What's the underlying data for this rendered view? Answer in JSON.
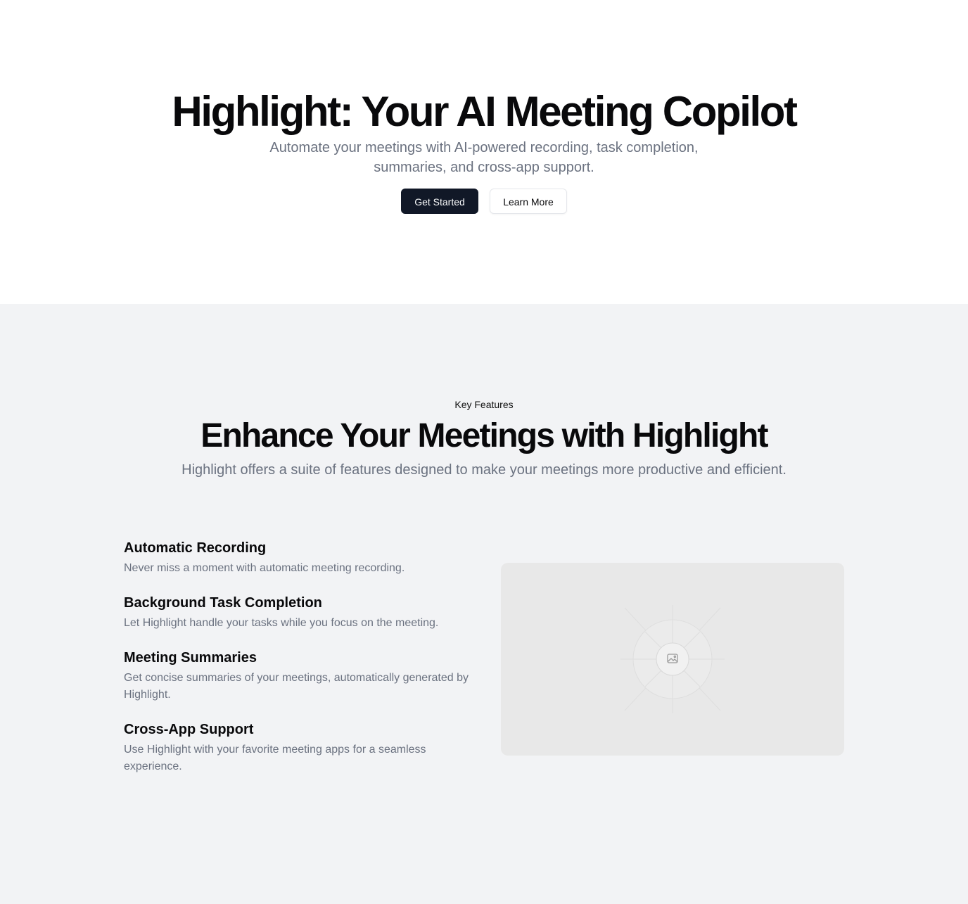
{
  "hero": {
    "title": "Highlight: Your AI Meeting Copilot",
    "subtitle": "Automate your meetings with AI-powered recording, task completion, summaries, and cross-app support.",
    "primary_button": "Get Started",
    "secondary_button": "Learn More"
  },
  "features": {
    "eyebrow": "Key Features",
    "title": "Enhance Your Meetings with Highlight",
    "subtitle": "Highlight offers a suite of features designed to make your meetings more productive and efficient.",
    "items": [
      {
        "title": "Automatic Recording",
        "description": "Never miss a moment with automatic meeting recording."
      },
      {
        "title": "Background Task Completion",
        "description": "Let Highlight handle your tasks while you focus on the meeting."
      },
      {
        "title": "Meeting Summaries",
        "description": "Get concise summaries of your meetings, automatically generated by Highlight."
      },
      {
        "title": "Cross-App Support",
        "description": "Use Highlight with your favorite meeting apps for a seamless experience."
      }
    ],
    "image_icon": "image-placeholder-icon"
  },
  "colors": {
    "primary_button_bg": "#111827",
    "features_bg": "#f2f3f5",
    "muted_text": "#6b7280",
    "placeholder_bg": "#e8e8e8"
  }
}
